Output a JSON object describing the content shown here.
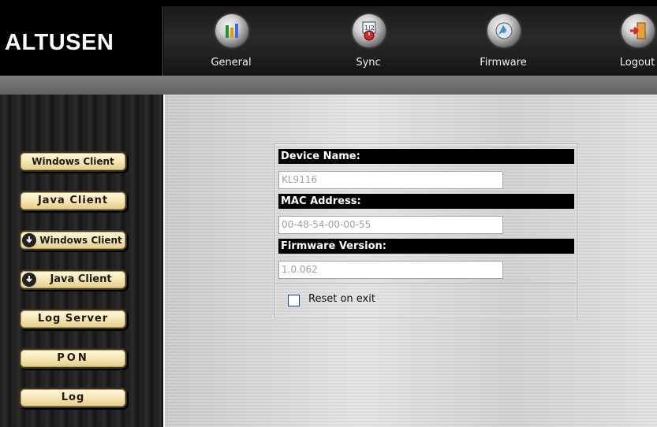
{
  "header": {
    "logo_text": "ALTUSEN",
    "nav": [
      {
        "label": "General",
        "icon": "general-icon"
      },
      {
        "label": "Sync",
        "icon": "sync-icon"
      },
      {
        "label": "Firmware",
        "icon": "firmware-icon"
      },
      {
        "label": "Logout",
        "icon": "logout-icon"
      }
    ]
  },
  "sidebar": {
    "buttons": [
      {
        "label": "Windows Client"
      },
      {
        "label": "Java Client"
      },
      {
        "label": "Windows Client",
        "icon": "download-icon"
      },
      {
        "label": "Java Client",
        "icon": "download-icon"
      },
      {
        "label": "Log Server"
      },
      {
        "label": "PON"
      },
      {
        "label": "Log"
      }
    ]
  },
  "device_info": {
    "device_name_label": "Device Name:",
    "device_name_value": "KL9116",
    "mac_label": "MAC Address:",
    "mac_value": "00-48-54-00-00-55",
    "firmware_label": "Firmware Version:",
    "firmware_value": "1.0.062",
    "reset_label": "Reset on exit",
    "reset_checked": false
  },
  "colors": {
    "header_bg": "#000000",
    "button_face": "#f6e6b4",
    "field_header_bg": "#000000"
  }
}
